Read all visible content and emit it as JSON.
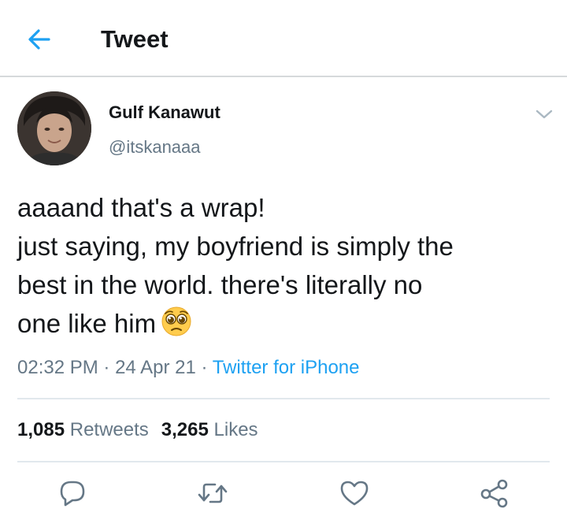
{
  "header": {
    "title": "Tweet",
    "back_icon": "arrow-left-icon"
  },
  "author": {
    "display_name": "Gulf Kanawut",
    "handle": "@itskanaaa"
  },
  "tweet": {
    "lines": [
      "aaaand that's a wrap!",
      "just saying, my boyfriend is simply the",
      "best in the world. there's literally no",
      "one like him"
    ],
    "emoji": "pleading-face"
  },
  "meta": {
    "time": "02:32 PM",
    "separator": "·",
    "date": "24 Apr 21",
    "source": "Twitter for iPhone"
  },
  "stats": {
    "retweets_count": "1,085",
    "retweets_label": "Retweets",
    "likes_count": "3,265",
    "likes_label": "Likes"
  },
  "actions": [
    "reply-icon",
    "retweet-icon",
    "like-icon",
    "share-icon"
  ],
  "colors": {
    "accent": "#1da1f2",
    "secondary_text": "#657786",
    "text": "#14171a",
    "divider": "#e1e8ed"
  }
}
